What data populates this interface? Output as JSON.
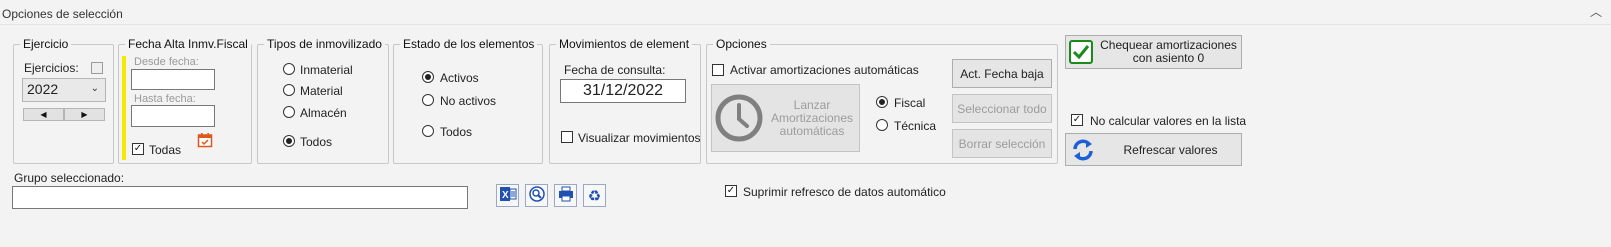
{
  "panel": {
    "title": "Opciones de selección"
  },
  "ejercicio": {
    "legend": "Ejercicio",
    "label": "Ejercicios:",
    "selected": "2022"
  },
  "fecha": {
    "legend": "Fecha Alta Inmv.Fiscal",
    "desde_label": "Desde fecha:",
    "hasta_label": "Hasta fecha:",
    "desde_value": "",
    "hasta_value": "",
    "todas_label": "Todas"
  },
  "tipos": {
    "legend": "Tipos de inmovilizado",
    "options": [
      "Inmaterial",
      "Material",
      "Almacén",
      "Todos"
    ]
  },
  "estado": {
    "legend": "Estado de los elementos",
    "options": [
      "Activos",
      "No activos",
      "Todos"
    ]
  },
  "movimientos": {
    "legend": "Movimientos de element",
    "fecha_label": "Fecha de consulta:",
    "fecha_value": "31/12/2022",
    "visualizar_label": "Visualizar movimientos"
  },
  "opciones": {
    "legend": "Opciones",
    "activar_label": "Activar amortizaciones automáticas",
    "lanzar_label": "Lanzar Amortizaciones automáticas",
    "fiscal_label": "Fiscal",
    "tecnica_label": "Técnica",
    "act_fecha_baja": "Act. Fecha baja",
    "seleccionar_todo": "Seleccionar todo",
    "borrar_seleccion": "Borrar selección"
  },
  "right": {
    "chequear_label": "Chequear  amortizaciones con asiento 0",
    "no_calcular_label": "No calcular valores en la lista",
    "refrescar_label": "Refrescar valores"
  },
  "grupo": {
    "label": "Grupo seleccionado:",
    "value": ""
  },
  "suprimir_label": "Suprimir refresco de datos automático",
  "colors": {
    "legend_red": "#8b1a1a",
    "yellow_bar": "#f3ea00",
    "check_green": "#1a8a1a",
    "refresh_blue": "#1c5fd6",
    "calendar_orange": "#e0571b"
  }
}
